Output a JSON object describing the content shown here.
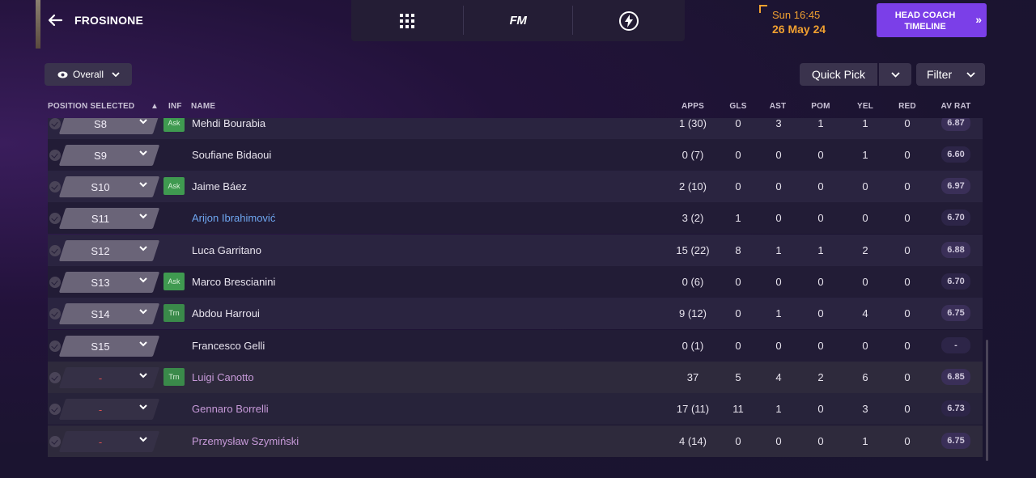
{
  "header": {
    "club_name": "FROSINONE",
    "nav_center_label": "FM",
    "date_time": "Sun 16:45",
    "date_day": "26 May 24",
    "hc_button_label": "HEAD COACH TIMELINE",
    "accent_color": "#7b3fe8",
    "date_color": "#f0a030"
  },
  "toolbar": {
    "view_label": "Overall",
    "quick_pick_label": "Quick Pick",
    "filter_label": "Filter"
  },
  "columns": {
    "position": "POSITION SELECTED",
    "inf": "INF",
    "name": "NAME",
    "apps": "APPS",
    "gls": "GLS",
    "ast": "AST",
    "pom": "POM",
    "yel": "YEL",
    "red": "RED",
    "av_rat": "AV RAT"
  },
  "rows": [
    {
      "pos": "S8",
      "inf": "Ask",
      "name": "Mehdi Bourabia",
      "apps": "1 (30)",
      "gls": "0",
      "ast": "3",
      "pom": "1",
      "yel": "1",
      "red": "0",
      "rat": "6.87"
    },
    {
      "pos": "S9",
      "inf": "",
      "name": "Soufiane Bidaoui",
      "apps": "0 (7)",
      "gls": "0",
      "ast": "0",
      "pom": "0",
      "yel": "1",
      "red": "0",
      "rat": "6.60"
    },
    {
      "pos": "S10",
      "inf": "Ask",
      "name": "Jaime Báez",
      "apps": "2 (10)",
      "gls": "0",
      "ast": "0",
      "pom": "0",
      "yel": "0",
      "red": "0",
      "rat": "6.97"
    },
    {
      "pos": "S11",
      "inf": "",
      "name": "Arijon Ibrahimović",
      "apps": "3 (2)",
      "gls": "1",
      "ast": "0",
      "pom": "0",
      "yel": "0",
      "red": "0",
      "rat": "6.70"
    },
    {
      "pos": "S12",
      "inf": "",
      "name": "Luca Garritano",
      "apps": "15 (22)",
      "gls": "8",
      "ast": "1",
      "pom": "1",
      "yel": "2",
      "red": "0",
      "rat": "6.88"
    },
    {
      "pos": "S13",
      "inf": "Ask",
      "name": "Marco Brescianini",
      "apps": "0 (6)",
      "gls": "0",
      "ast": "0",
      "pom": "0",
      "yel": "0",
      "red": "0",
      "rat": "6.70"
    },
    {
      "pos": "S14",
      "inf": "Trn",
      "name": "Abdou Harroui",
      "apps": "9 (12)",
      "gls": "0",
      "ast": "1",
      "pom": "0",
      "yel": "4",
      "red": "0",
      "rat": "6.75"
    },
    {
      "pos": "S15",
      "inf": "",
      "name": "Francesco Gelli",
      "apps": "0 (1)",
      "gls": "0",
      "ast": "0",
      "pom": "0",
      "yel": "0",
      "red": "0",
      "rat": "-"
    },
    {
      "pos": "-",
      "inf": "Trn",
      "name": "Luigi Canotto",
      "apps": "37",
      "gls": "5",
      "ast": "4",
      "pom": "2",
      "yel": "6",
      "red": "0",
      "rat": "6.85"
    },
    {
      "pos": "-",
      "inf": "",
      "name": "Gennaro Borrelli",
      "apps": "17 (11)",
      "gls": "11",
      "ast": "1",
      "pom": "0",
      "yel": "3",
      "red": "0",
      "rat": "6.73"
    },
    {
      "pos": "-",
      "inf": "",
      "name": "Przemysław Szymiński",
      "apps": "4 (14)",
      "gls": "0",
      "ast": "0",
      "pom": "0",
      "yel": "1",
      "red": "0",
      "rat": "6.75"
    }
  ]
}
